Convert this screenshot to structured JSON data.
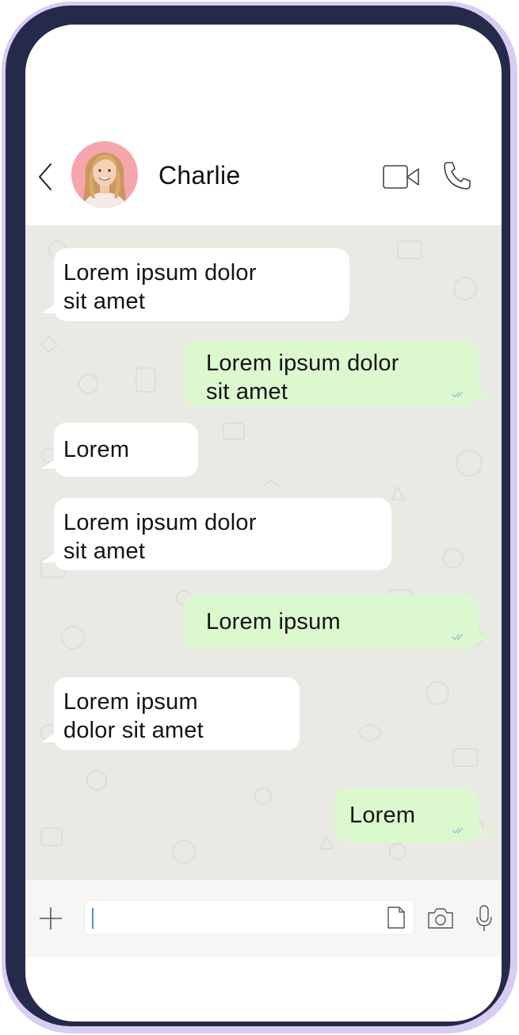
{
  "contact": {
    "name": "Charlie",
    "avatar_bg": "#f4a6ac"
  },
  "header": {
    "back_icon": "chevron-left-icon",
    "video_icon": "video-camera-icon",
    "call_icon": "phone-icon"
  },
  "messages": [
    {
      "direction": "in",
      "line1": "Lorem ipsum dolor",
      "line2": "sit amet"
    },
    {
      "direction": "out",
      "line1": "Lorem ipsum dolor",
      "line2": "sit amet",
      "status": "read-ticks"
    },
    {
      "direction": "in",
      "line1": "Lorem",
      "line2": ""
    },
    {
      "direction": "in",
      "line1": "Lorem ipsum dolor",
      "line2": "sit amet"
    },
    {
      "direction": "out",
      "line1": "Lorem ipsum",
      "line2": "",
      "status": "read-ticks"
    },
    {
      "direction": "in",
      "line1": "Lorem ipsum",
      "line2": "dolor sit amet"
    },
    {
      "direction": "out",
      "line1": "Lorem",
      "line2": "",
      "status": "read-ticks"
    }
  ],
  "composer": {
    "input_value": "",
    "plus_icon": "plus-icon",
    "attach_icon": "document-icon",
    "camera_icon": "camera-icon",
    "mic_icon": "microphone-icon"
  },
  "colors": {
    "phone_frame": "#262a4a",
    "phone_rim": "#d9ccf2",
    "chat_bg": "#e8eae3",
    "incoming_bubble": "#ffffff",
    "outgoing_bubble": "#dcf8cf",
    "ticks": "#8fb8d9"
  }
}
